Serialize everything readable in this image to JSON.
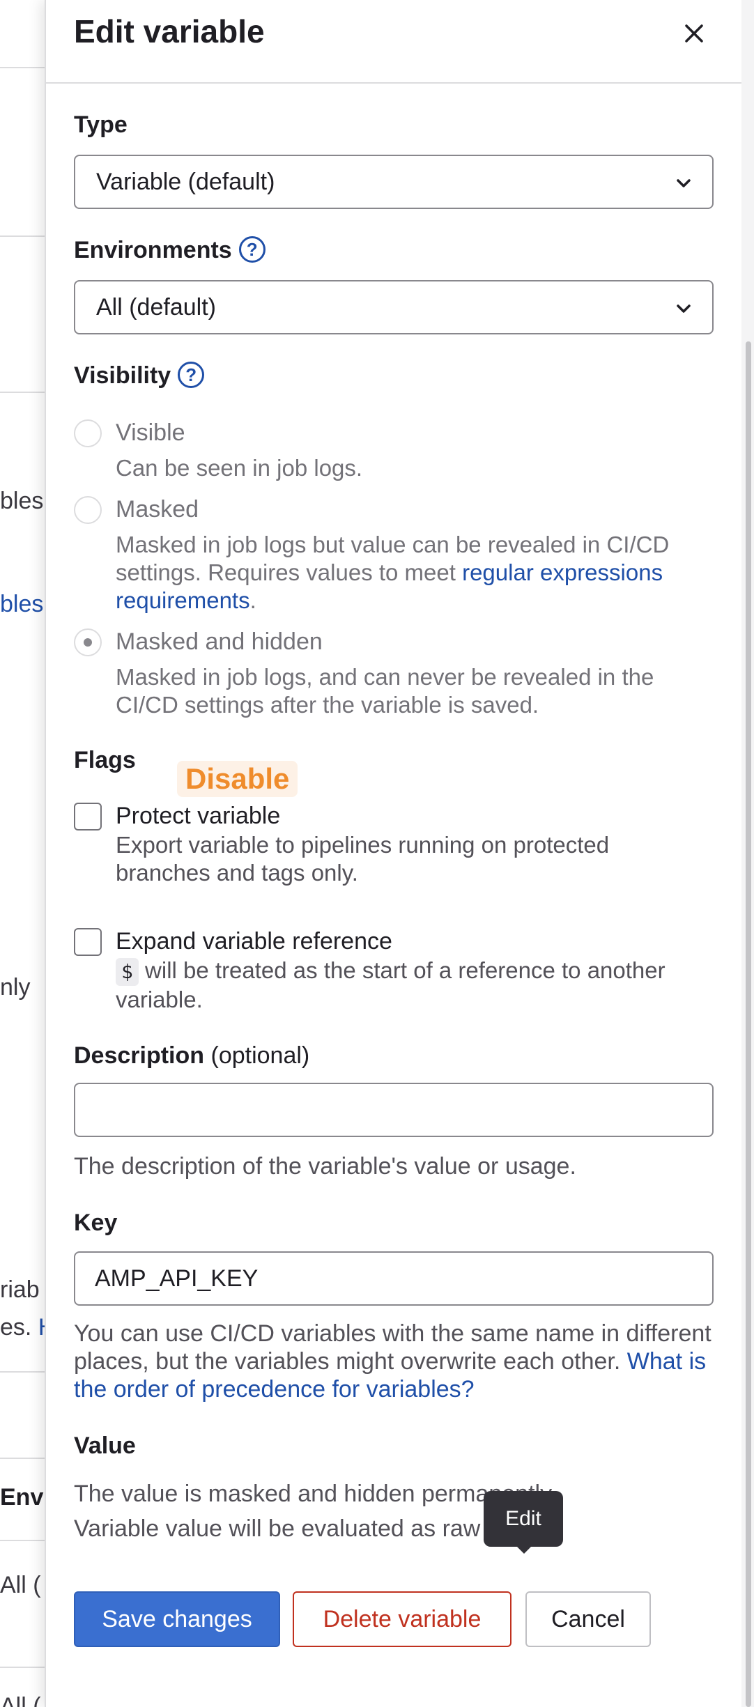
{
  "background": {
    "fragments": [
      "bles",
      "bles",
      "nly",
      "riab",
      "es.",
      "H",
      "Envi",
      "All (",
      "All ("
    ]
  },
  "drawer": {
    "title": "Edit variable",
    "type": {
      "label": "Type",
      "value": "Variable (default)"
    },
    "environments": {
      "label": "Environments",
      "value": "All (default)"
    },
    "visibility": {
      "label": "Visibility",
      "options": [
        {
          "title": "Visible",
          "desc": "Can be seen in job logs.",
          "checked": false
        },
        {
          "title": "Masked",
          "desc_pre": "Masked in job logs but value can be revealed in CI/CD settings. Requires values to meet ",
          "desc_link": "regular expressions requirements",
          "desc_post": ".",
          "checked": false
        },
        {
          "title": "Masked and hidden",
          "desc": "Masked in job logs, and can never be revealed in the CI/CD settings after the variable is saved.",
          "checked": true
        }
      ]
    },
    "flags": {
      "label": "Flags",
      "annotation": "Disable",
      "protect": {
        "title": "Protect variable",
        "desc": "Export variable to pipelines running on protected branches and tags only.",
        "checked": false
      },
      "expand": {
        "title": "Expand variable reference",
        "code": "$",
        "desc": "will be treated as the start of a reference to another variable.",
        "checked": false
      }
    },
    "description": {
      "label": "Description",
      "optional": "(optional)",
      "value": "",
      "help": "The description of the variable's value or usage."
    },
    "key": {
      "label": "Key",
      "value": "AMP_API_KEY",
      "help": "You can use CI/CD variables with the same name in different places, but the variables might overwrite each other.",
      "help_link": "What is the order of precedence for variables?"
    },
    "value": {
      "label": "Value",
      "line1": "The value is masked and hidden permanently.",
      "line2": "Variable value will be evaluated as raw string."
    },
    "tooltip": "Edit",
    "buttons": {
      "save": "Save changes",
      "delete": "Delete variable",
      "cancel": "Cancel"
    }
  },
  "colors": {
    "primary": "#3a6fd0",
    "danger": "#c0311f",
    "link": "#1f4fa8",
    "annotation": "#ef8c2c"
  }
}
